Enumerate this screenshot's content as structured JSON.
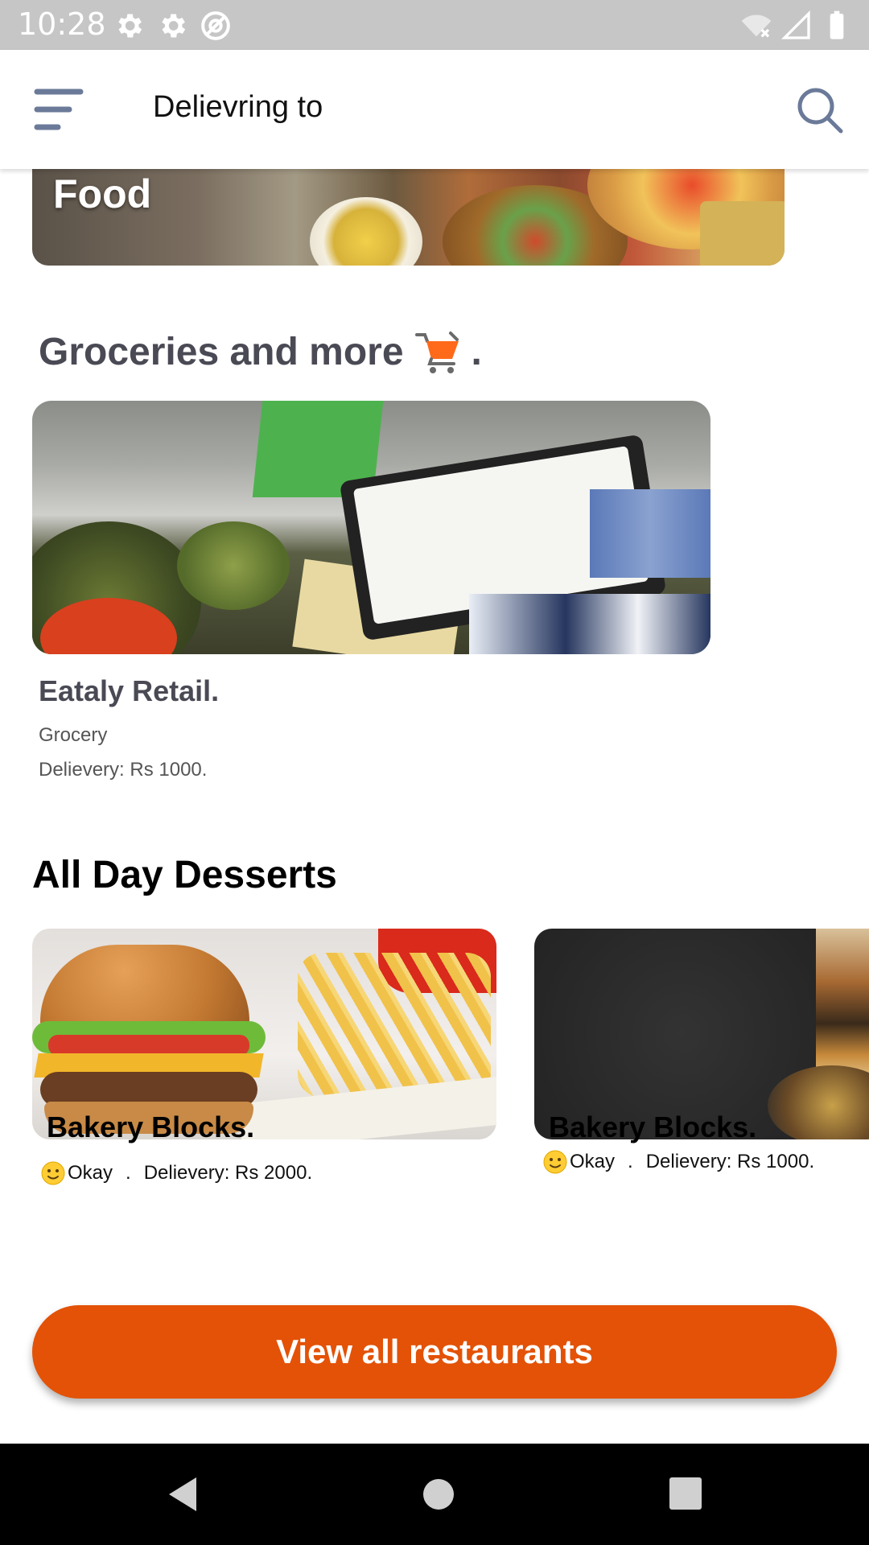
{
  "status_bar": {
    "time": "10:28",
    "left_icons": [
      "gear-icon",
      "gear-icon",
      "at-sign-icon"
    ],
    "right_icons": [
      "wifi-off-icon",
      "signal-icon",
      "battery-icon"
    ]
  },
  "app_bar": {
    "title": "Delievring to",
    "menu_icon": "hamburger-menu-icon",
    "search_icon": "search-icon"
  },
  "food_banner": {
    "label": "Food"
  },
  "groceries": {
    "title": "Groceries and more",
    "title_suffix": ".",
    "title_icon": "shopping-cart-icon",
    "store": {
      "name": "Eataly Retail.",
      "category": "Grocery",
      "delivery": "Delievery: Rs 1000."
    }
  },
  "desserts": {
    "title": "All Day Desserts",
    "items": [
      {
        "name": "Bakery Blocks.",
        "rating": "Okay",
        "separator": ".",
        "delivery": "Delievery: Rs 2000."
      },
      {
        "name": "Bakery Blocks.",
        "rating": "Okay",
        "separator": ".",
        "delivery": "Delievery: Rs 1000."
      }
    ]
  },
  "view_all_button": {
    "label": "View all restaurants"
  },
  "colors": {
    "accent": "#e35207",
    "heading_gray": "#4a4a55",
    "status_bar": "#c6c6c6",
    "nav_bar": "#000000"
  }
}
